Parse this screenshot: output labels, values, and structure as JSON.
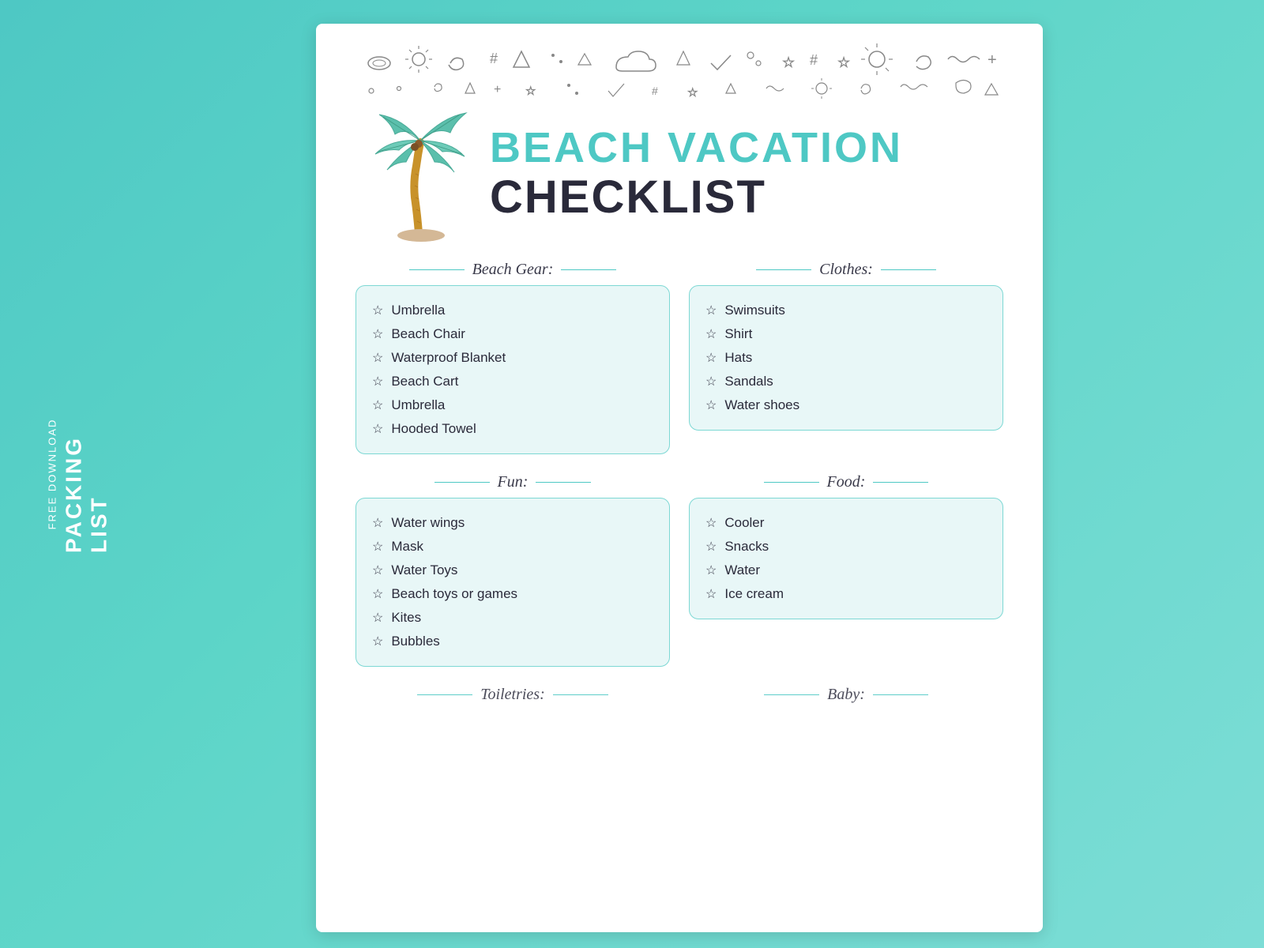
{
  "sidebar": {
    "free_download": "FREE DOWNLOAD",
    "packing_list": "PACKING LIST"
  },
  "header": {
    "line1": "BEACH VACATION",
    "line2": "CHECKLIST"
  },
  "sections": [
    {
      "id": "beach-gear",
      "title": "Beach Gear:",
      "items": [
        "Umbrella",
        "Beach Chair",
        "Waterproof Blanket",
        "Beach Cart",
        "Umbrella",
        "Hooded Towel"
      ]
    },
    {
      "id": "clothes",
      "title": "Clothes:",
      "items": [
        "Swimsuits",
        "Shirt",
        "Hats",
        "Sandals",
        "Water shoes"
      ]
    },
    {
      "id": "fun",
      "title": "Fun:",
      "items": [
        "Water wings",
        "Mask",
        "Water Toys",
        "Beach toys or games",
        "Kites",
        "Bubbles"
      ]
    },
    {
      "id": "food",
      "title": "Food:",
      "items": [
        "Cooler",
        "Snacks",
        "Water",
        "Ice cream"
      ]
    }
  ],
  "bottom_sections": [
    {
      "title": "Toiletries:"
    },
    {
      "title": "Baby:"
    }
  ]
}
